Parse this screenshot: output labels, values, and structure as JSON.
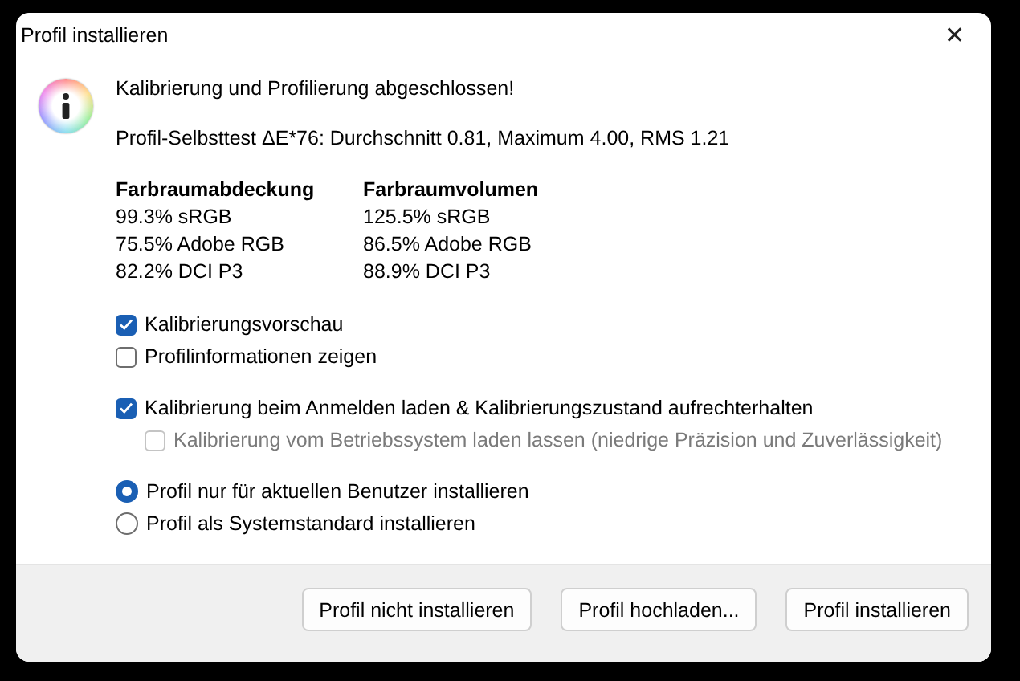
{
  "window": {
    "title": "Profil installieren",
    "close": "✕"
  },
  "message": "Kalibrierung und Profilierung abgeschlossen!",
  "self_test": "Profil-Selbsttest ΔE*76: Durchschnitt 0.81, Maximum 4.00, RMS 1.21",
  "gamut_columns": [
    {
      "heading": "Farbraumabdeckung",
      "rows": [
        "99.3% sRGB",
        "75.5% Adobe RGB",
        "82.2% DCI P3"
      ]
    },
    {
      "heading": "Farbraumvolumen",
      "rows": [
        "125.5% sRGB",
        "86.5% Adobe RGB",
        "88.9% DCI P3"
      ]
    }
  ],
  "option_groups": [
    [
      {
        "kind": "checkbox",
        "label": "Kalibrierungsvorschau",
        "checked": true,
        "disabled": false
      },
      {
        "kind": "checkbox",
        "label": "Profilinformationen zeigen",
        "checked": false,
        "disabled": false
      }
    ],
    [
      {
        "kind": "checkbox",
        "label": "Kalibrierung beim Anmelden laden & Kalibrierungszustand aufrechterhalten",
        "checked": true,
        "disabled": false,
        "children": [
          {
            "kind": "checkbox",
            "label": "Kalibrierung vom Betriebssystem laden lassen (niedrige Präzision und Zuverlässigkeit)",
            "checked": false,
            "disabled": true
          }
        ]
      }
    ],
    [
      {
        "kind": "radio",
        "label": "Profil nur für aktuellen Benutzer installieren",
        "selected": true,
        "disabled": false
      },
      {
        "kind": "radio",
        "label": "Profil als Systemstandard installieren",
        "selected": false,
        "disabled": false
      }
    ]
  ],
  "buttons": [
    "Profil nicht installieren",
    "Profil hochladen...",
    "Profil installieren"
  ]
}
